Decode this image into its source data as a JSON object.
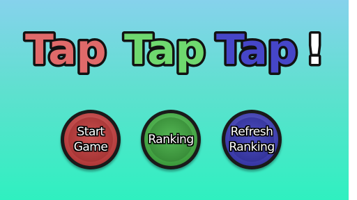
{
  "title": {
    "word1": "Tap",
    "word2": "Tap",
    "word3": "Tap",
    "exclaim": "!",
    "colors": {
      "word1": "#e06a6a",
      "word2": "#6fd86f",
      "word3": "#4646c8",
      "exclaim": "#ffffff"
    }
  },
  "menu": {
    "start_label": "Start\nGame",
    "ranking_label": "Ranking",
    "refresh_label": "Refresh\nRanking"
  }
}
